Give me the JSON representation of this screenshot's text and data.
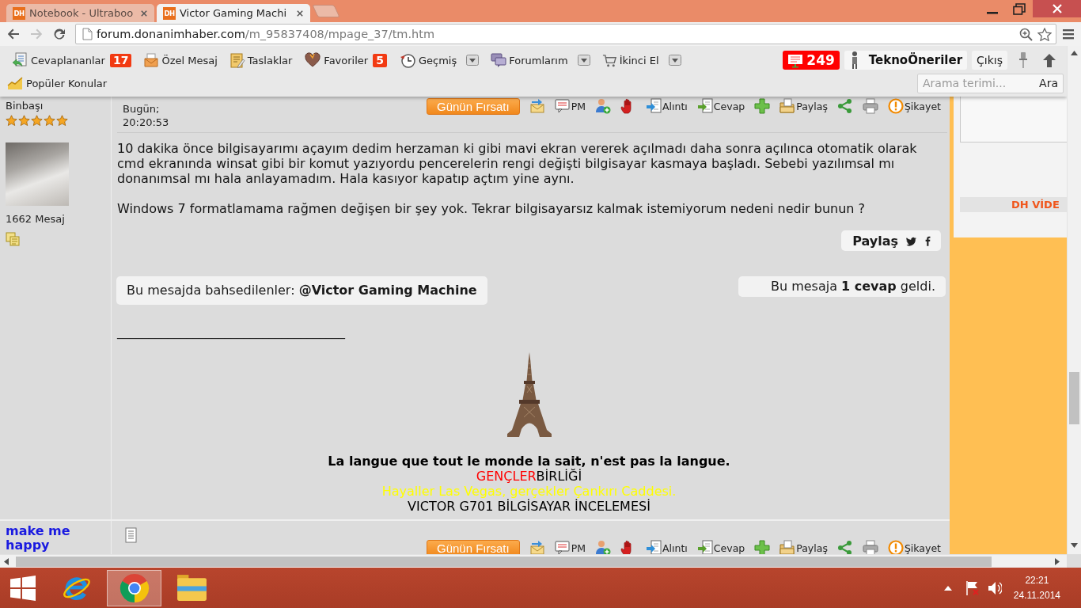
{
  "browser": {
    "tabs": [
      {
        "favicon": "DH",
        "title": "Notebook - Ultraboo",
        "selected": false
      },
      {
        "favicon": "DH",
        "title": "Victor Gaming Machi",
        "selected": true
      }
    ],
    "address": {
      "host": "forum.donanimhaber.com",
      "path": "/m_95837408/mpage_37/tm.htm",
      "forward_enabled": false
    }
  },
  "toolbar": {
    "items": [
      {
        "label": "Cevaplananlar",
        "badge": "17",
        "dropdown": false
      },
      {
        "label": "Özel Mesaj",
        "dropdown": false
      },
      {
        "label": "Taslaklar",
        "dropdown": false
      },
      {
        "label": "Favoriler",
        "badge": "5",
        "dropdown": false
      },
      {
        "label": "Geçmiş",
        "dropdown": true
      },
      {
        "label": "Forumlarım",
        "dropdown": true
      },
      {
        "label": "İkinci El",
        "dropdown": true
      }
    ],
    "notifications": "249",
    "user": "TeknoÖneriler",
    "logout": "Çıkış",
    "popular": "Popüler Konular",
    "search": {
      "placeholder": "Arama terimi...",
      "button": "Ara"
    }
  },
  "posts": [
    {
      "rank": "Binbaşı",
      "stars": 5,
      "message_count": "1662 Mesaj",
      "date": "Bugün;",
      "time": "20:20:53",
      "deal_button": "Günün Fırsatı",
      "actions": [
        "PM",
        "Alıntı",
        "Cevap",
        "Paylaş",
        "Şikayet"
      ],
      "body": [
        "10 dakika önce bilgisayarımı açayım dedim herzaman ki gibi mavi ekran vererek açılmadı daha sonra açılınca otomatik olarak cmd ekranında winsat gibi bir komut yazıyordu pencerelerin rengi değişti bilgisayar kasmaya başladı. Sebebi yazılımsal mı donanımsal mı hala anlayamadım. Hala kasıyor kapatıp açtım yine aynı.",
        "Windows 7 formatlamama rağmen değişen bir şey yok. Tekrar bilgisayarsız kalmak istemiyorum nedeni nedir bunun ?"
      ],
      "share_label": "Paylaş",
      "mentions": "Bu mesajda bahsedilenler: **@Victor Gaming Machine**",
      "replies": "Bu mesaja **1 cevap** geldi.",
      "signature": {
        "rule": "____________________________________",
        "lines": [
          {
            "kind": "quote",
            "segments": [
              {
                "text": "La langue que tout le monde la sait, n'est pas la langue.",
                "color": "#000000"
              }
            ]
          },
          {
            "kind": "plain",
            "segments": [
              {
                "text": "GENÇLER",
                "color": "#ff0000"
              },
              {
                "text": "BİRLİĞİ",
                "color": "#000000"
              }
            ]
          },
          {
            "kind": "plain",
            "segments": [
              {
                "text": "Hayaller Las Vegas, gerçekler Çankırı Caddesi.",
                "color": "#ffff00"
              }
            ]
          },
          {
            "kind": "plain",
            "segments": [
              {
                "text": "VICTOR G701 BİLGİSAYAR İNCELEMESİ",
                "color": "#000000"
              }
            ]
          }
        ]
      }
    },
    {
      "username": "make me happy",
      "deal_button": "Günün Fırsatı",
      "actions": [
        "PM",
        "Alıntı",
        "Cevap",
        "Paylaş",
        "Şikayet"
      ]
    }
  ],
  "sidebar": {
    "section_title": "DH VİDE"
  },
  "taskbar": {
    "apps": [
      {
        "selected": false
      },
      {
        "selected": true
      },
      {
        "selected": false
      }
    ],
    "time": "22:21",
    "date": "24.11.2014"
  }
}
